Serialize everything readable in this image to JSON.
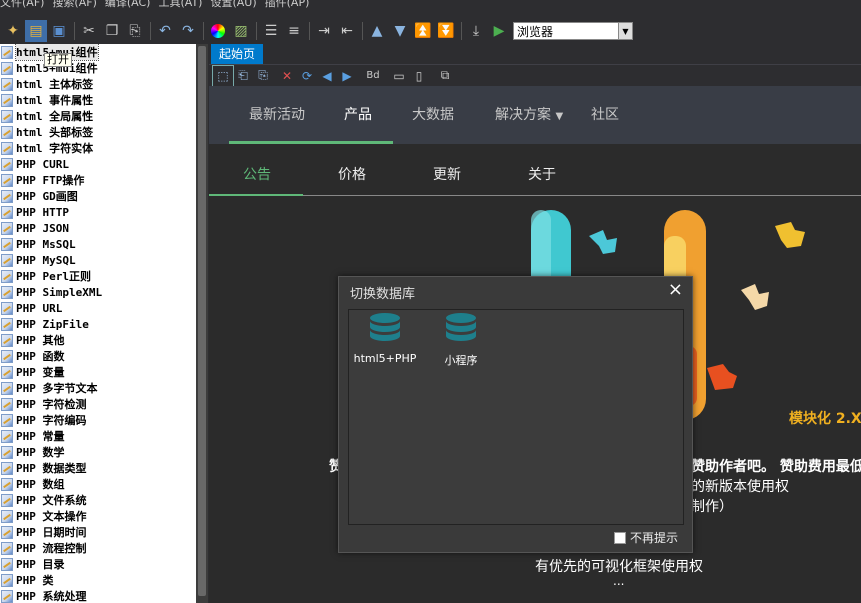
{
  "menu": [
    "文件(AF)",
    "搜索(AF)",
    "编译(AC)",
    "工具(AT)",
    "设置(AU)",
    "插件(AP)"
  ],
  "toolbar": {
    "browser_select": "浏览器"
  },
  "tree": {
    "items": [
      "html5+mui组件",
      "html5+mui组件",
      "html 主体标签",
      "html 事件属性",
      "html 全局属性",
      "html 头部标签",
      "html 字符实体",
      "PHP CURL",
      "PHP FTP操作",
      "PHP GD画图",
      "PHP HTTP",
      "PHP JSON",
      "PHP MsSQL",
      "PHP MySQL",
      "PHP Perl正则",
      "PHP SimpleXML",
      "PHP URL",
      "PHP ZipFile",
      "PHP 其他",
      "PHP 函数",
      "PHP 变量",
      "PHP 多字节文本",
      "PHP 字符检测",
      "PHP 字符编码",
      "PHP 常量",
      "PHP 数学",
      "PHP 数据类型",
      "PHP 数组",
      "PHP 文件系统",
      "PHP 文本操作",
      "PHP 日期时间",
      "PHP 流程控制",
      "PHP 目录",
      "PHP 类",
      "PHP 系统处理"
    ],
    "tooltip": "打开"
  },
  "editor": {
    "tab_label": "起始页"
  },
  "preview": {
    "nav1": [
      "最新活动",
      "产品",
      "大数据",
      "解决方案",
      "社区"
    ],
    "nav1_dropdown_arrow": "▼",
    "nav2": [
      "公告",
      "价格",
      "更新",
      "关于"
    ],
    "modular_text": "模块化 2.X",
    "line_a_left": "赞",
    "line_a_right": "赞助作者吧。 赞助费用最低",
    "line_b": "的新版本使用权",
    "line_c": "制作）",
    "line_d": "有优先的可视化框架使用权",
    "line_e": "..."
  },
  "modal": {
    "title": "切换数据库",
    "close": "×",
    "items": [
      "html5+PHP",
      "小程序"
    ],
    "dont_show": "不再提示"
  },
  "colors": {
    "accent_green": "#5fb878",
    "tab_blue": "#007acc",
    "db_teal": "#1e7f8c"
  }
}
